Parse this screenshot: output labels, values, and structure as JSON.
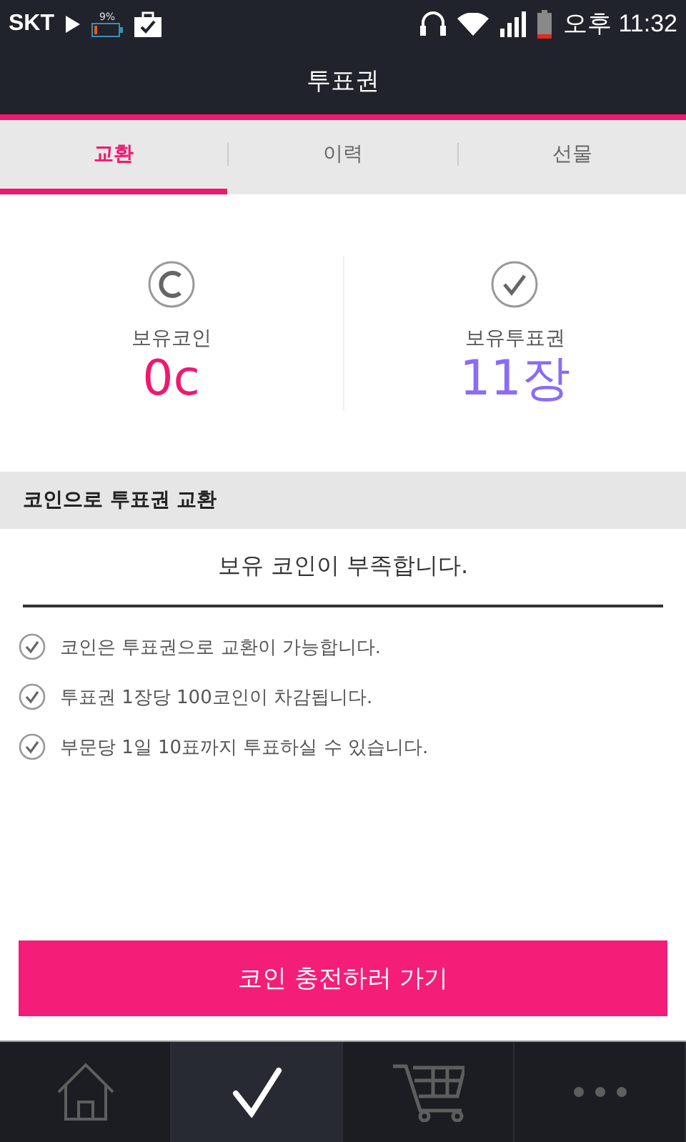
{
  "status_bar": {
    "carrier": "SKT",
    "battery_percent": "9%",
    "time": "오후 11:32"
  },
  "window": {
    "title": "투표권"
  },
  "tabs": [
    {
      "label": "교환",
      "selected": true
    },
    {
      "label": "이력",
      "selected": false
    },
    {
      "label": "선물",
      "selected": false
    }
  ],
  "balances": [
    {
      "kind": "coin",
      "label": "보유코인",
      "value": "0c",
      "color": "#f0186e"
    },
    {
      "kind": "ticket",
      "label": "보유투표권",
      "value": "11장",
      "color": "#8a6cf5"
    }
  ],
  "section": {
    "title": "코인으로 투표권 교환",
    "message": "보유 코인이 부족합니다."
  },
  "notes": [
    "코인은 투표권으로 교환이 가능합니다.",
    "투표권 1장당 100코인이 차감됩니다.",
    "부문당 1일 10표까지 투표하실 수 있습니다."
  ],
  "action_button": {
    "label": "코인 충전하러 가기"
  },
  "bottom_nav": [
    {
      "kind": "home",
      "selected": false
    },
    {
      "kind": "check",
      "selected": true
    },
    {
      "kind": "cart",
      "selected": false
    },
    {
      "kind": "more",
      "selected": false
    }
  ]
}
